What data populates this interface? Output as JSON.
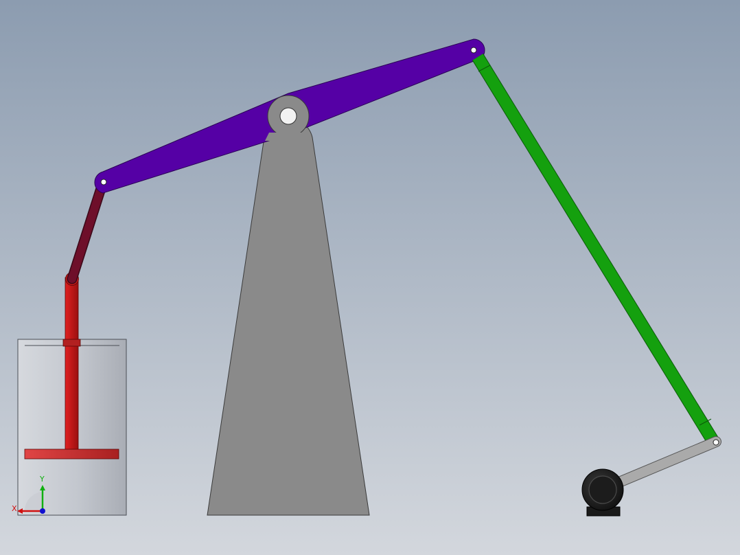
{
  "scene": {
    "background_top": "#8c9cb0",
    "background_bottom": "#d3d7dd"
  },
  "parts": {
    "beam": {
      "color": "#5500a5"
    },
    "samson_post": {
      "color": "#8a8a8a"
    },
    "pitman_arm": {
      "color": "#14a00e"
    },
    "crank": {
      "color": "#aaaaaa"
    },
    "motor": {
      "color": "#1a1a1a"
    },
    "connecting_link": {
      "color": "#6e0f2a"
    },
    "piston_rod": {
      "color": "#c01818"
    },
    "piston": {
      "color": "#d03030"
    },
    "cylinder": {
      "color": "#c6cad1"
    }
  },
  "triad": {
    "x_label": "X",
    "y_label": "Y",
    "x_color": "#d01010",
    "y_color": "#10b010",
    "z_color": "#1010d0"
  }
}
